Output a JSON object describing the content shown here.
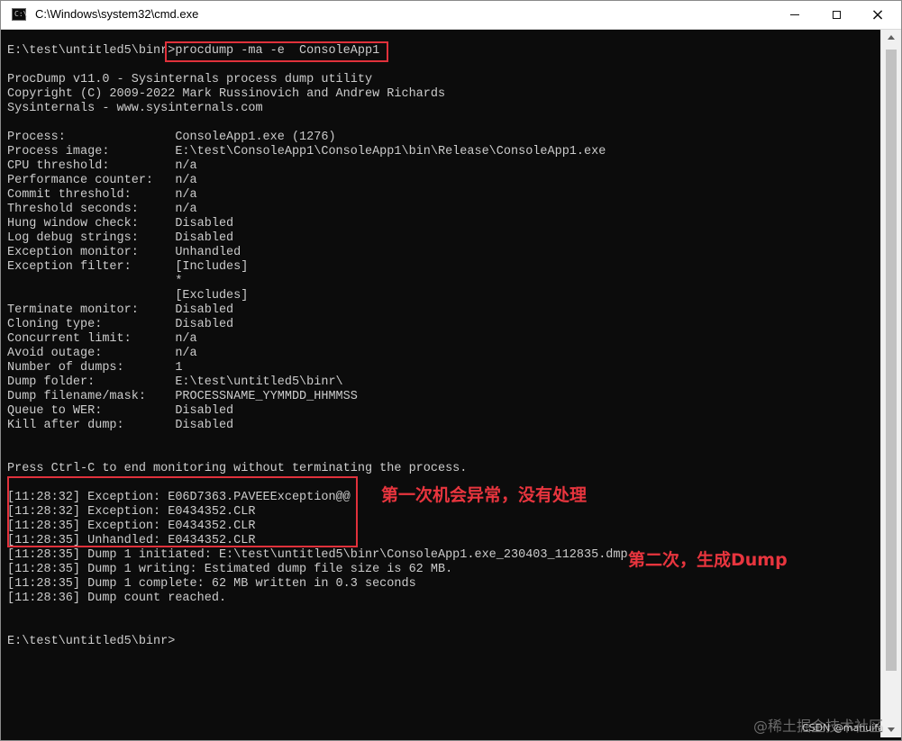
{
  "window": {
    "title": "C:\\Windows\\system32\\cmd.exe",
    "icon_label": "C:\\"
  },
  "controls": {
    "minimize": "minimize-icon",
    "maximize": "maximize-icon",
    "close": "×"
  },
  "console": {
    "lines": [
      "E:\\test\\untitled5\\binr>procdump -ma -e  ConsoleApp1",
      "",
      "ProcDump v11.0 - Sysinternals process dump utility",
      "Copyright (C) 2009-2022 Mark Russinovich and Andrew Richards",
      "Sysinternals - www.sysinternals.com",
      "",
      "Process:               ConsoleApp1.exe (1276)",
      "Process image:         E:\\test\\ConsoleApp1\\ConsoleApp1\\bin\\Release\\ConsoleApp1.exe",
      "CPU threshold:         n/a",
      "Performance counter:   n/a",
      "Commit threshold:      n/a",
      "Threshold seconds:     n/a",
      "Hung window check:     Disabled",
      "Log debug strings:     Disabled",
      "Exception monitor:     Unhandled",
      "Exception filter:      [Includes]",
      "                       *",
      "                       [Excludes]",
      "Terminate monitor:     Disabled",
      "Cloning type:          Disabled",
      "Concurrent limit:      n/a",
      "Avoid outage:          n/a",
      "Number of dumps:       1",
      "Dump folder:           E:\\test\\untitled5\\binr\\",
      "Dump filename/mask:    PROCESSNAME_YYMMDD_HHMMSS",
      "Queue to WER:          Disabled",
      "Kill after dump:       Disabled",
      "",
      "",
      "Press Ctrl-C to end monitoring without terminating the process.",
      "",
      "[11:28:32] Exception: E06D7363.PAVEEException@@",
      "[11:28:32] Exception: E0434352.CLR",
      "[11:28:35] Exception: E0434352.CLR",
      "[11:28:35] Unhandled: E0434352.CLR",
      "[11:28:35] Dump 1 initiated: E:\\test\\untitled5\\binr\\ConsoleApp1.exe_230403_112835.dmp",
      "[11:28:35] Dump 1 writing: Estimated dump file size is 62 MB.",
      "[11:28:35] Dump 1 complete: 62 MB written in 0.3 seconds",
      "[11:28:36] Dump count reached.",
      "",
      "",
      "E:\\test\\untitled5\\binr>"
    ]
  },
  "annotations": {
    "first": "第一次机会异常，没有处理",
    "second": "第二次，生成Dump",
    "color": "#e8353e"
  },
  "watermark": {
    "text": "@稀土掘金技术社区",
    "subtext": "CSDN @mahuifa"
  }
}
